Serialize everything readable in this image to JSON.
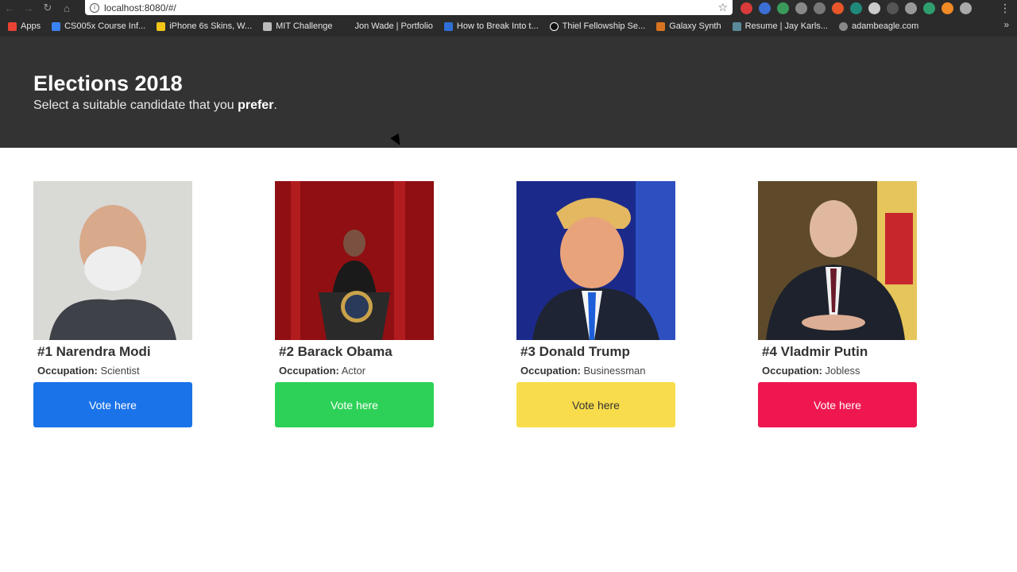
{
  "browser": {
    "url": "localhost:8080/#/",
    "bookmarks": [
      {
        "label": "Apps",
        "color": "#e94235"
      },
      {
        "label": "CS005x Course Inf...",
        "color": "#3b82f6"
      },
      {
        "label": "iPhone 6s Skins, W...",
        "color": "#f5c518"
      },
      {
        "label": "MIT Challenge",
        "color": "#bbbbbb"
      },
      {
        "label": "Jon Wade | Portfolio",
        "color": "#2b2b2b"
      },
      {
        "label": "How to Break Into t...",
        "color": "#2f6fd6"
      },
      {
        "label": "Thiel Fellowship Se...",
        "color": "#111111"
      },
      {
        "label": "Galaxy Synth",
        "color": "#d9731f"
      },
      {
        "label": "Resume | Jay Karls...",
        "color": "#5a8a9a"
      },
      {
        "label": "adambeagle.com",
        "color": "#888888"
      }
    ]
  },
  "header": {
    "title": "Elections 2018",
    "subtitle_before": "Select a suitable candidate that you ",
    "subtitle_bold": "prefer",
    "subtitle_after": "."
  },
  "candidates": [
    {
      "name": "#1 Narendra Modi",
      "occupation_label": "Occupation:",
      "occupation": "Scientist",
      "vote_label": "Vote here",
      "button_color": "#1a73e8",
      "button_text_color": "#ffffff",
      "photo_bg": "#d9d9d6"
    },
    {
      "name": "#2 Barack Obama",
      "occupation_label": "Occupation:",
      "occupation": "Actor",
      "vote_label": "Vote here",
      "button_color": "#2ed157",
      "button_text_color": "#ffffff",
      "photo_bg": "#7a0a0a"
    },
    {
      "name": "#3 Donald Trump",
      "occupation_label": "Occupation:",
      "occupation": "Businessman",
      "vote_label": "Vote here",
      "button_color": "#f8dc4b",
      "button_text_color": "#333333",
      "photo_bg": "#1b2a8a"
    },
    {
      "name": "#4 Vladmir Putin",
      "occupation_label": "Occupation:",
      "occupation": "Jobless",
      "vote_label": "Vote here",
      "button_color": "#ee1750",
      "button_text_color": "#ffffff",
      "photo_bg": "#5e4a2a"
    }
  ]
}
